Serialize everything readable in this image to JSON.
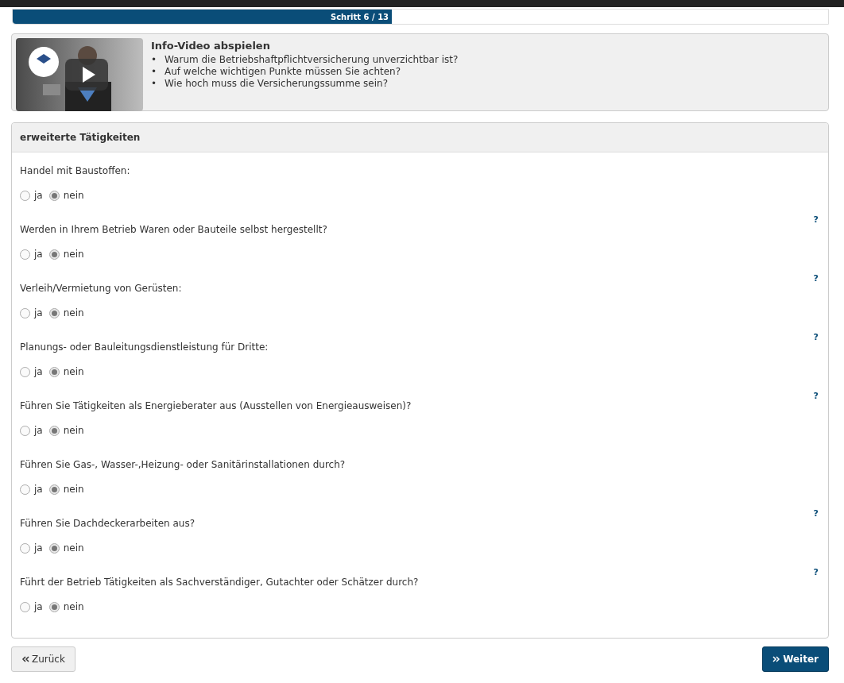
{
  "progress": {
    "label": "Schritt 6 / 13",
    "level": 0.465
  },
  "video": {
    "title": "Info-Video abspielen",
    "bullet": "•",
    "points": [
      "Warum die Betriebshaftpflichtversicherung unverzichtbar ist?",
      "Auf welche wichtigen Punkte müssen Sie achten?",
      "Wie hoch muss die Versicherungssumme sein?"
    ]
  },
  "section": {
    "title": "erweiterte Tätigkeiten",
    "questions": [
      {
        "text": "Handel mit Baustoffen:",
        "help": false,
        "options": [
          {
            "label": "ja",
            "selected": false
          },
          {
            "label": "nein",
            "selected": true
          }
        ]
      },
      {
        "text": "Werden in Ihrem Betrieb Waren oder Bauteile selbst hergestellt?",
        "help": true,
        "options": [
          {
            "label": "ja",
            "selected": false
          },
          {
            "label": "nein",
            "selected": true
          }
        ]
      },
      {
        "text": "Verleih/Vermietung von Gerüsten:",
        "help": true,
        "options": [
          {
            "label": "ja",
            "selected": false
          },
          {
            "label": "nein",
            "selected": true
          }
        ]
      },
      {
        "text": "Planungs- oder Bauleitungsdienstleistung für Dritte:",
        "help": true,
        "options": [
          {
            "label": "ja",
            "selected": false
          },
          {
            "label": "nein",
            "selected": true
          }
        ]
      },
      {
        "text": "Führen Sie Tätigkeiten als Energieberater aus (Ausstellen von Energieausweisen)?",
        "help": true,
        "options": [
          {
            "label": "ja",
            "selected": false
          },
          {
            "label": "nein",
            "selected": true
          }
        ]
      },
      {
        "text": "Führen Sie Gas-, Wasser-,Heizung- oder Sanitärinstallationen durch?",
        "help": false,
        "options": [
          {
            "label": "ja",
            "selected": false
          },
          {
            "label": "nein",
            "selected": true
          }
        ]
      },
      {
        "text": "Führen Sie Dachdeckerarbeiten aus?",
        "help": true,
        "options": [
          {
            "label": "ja",
            "selected": false
          },
          {
            "label": "nein",
            "selected": true
          }
        ]
      },
      {
        "text": "Führt der Betrieb Tätigkeiten als Sachverständiger, Gutachter oder Schätzer durch?",
        "help": true,
        "options": [
          {
            "label": "ja",
            "selected": false
          },
          {
            "label": "nein",
            "selected": true
          }
        ]
      }
    ],
    "help_label": "?"
  },
  "buttons": {
    "back": "Zurück",
    "next": "Weiter"
  }
}
